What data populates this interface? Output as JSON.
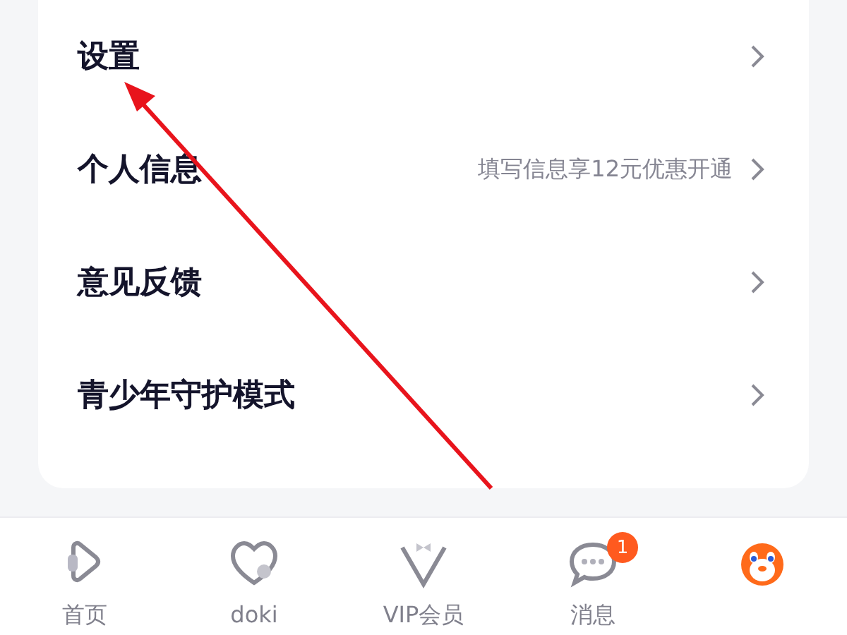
{
  "menu": [
    {
      "label": "设置"
    },
    {
      "label": "个人信息",
      "hint": "填写信息享12元优惠开通"
    },
    {
      "label": "意见反馈"
    },
    {
      "label": "青少年守护模式"
    }
  ],
  "annotation": {
    "kind": "arrow"
  },
  "tab_bar": [
    {
      "kind": "home",
      "label": "首页"
    },
    {
      "kind": "heart",
      "label": "doki"
    },
    {
      "kind": "vip",
      "label": "VIP会员"
    },
    {
      "kind": "chat",
      "label": "消息",
      "badge": "1"
    },
    {
      "kind": "mascot"
    }
  ]
}
